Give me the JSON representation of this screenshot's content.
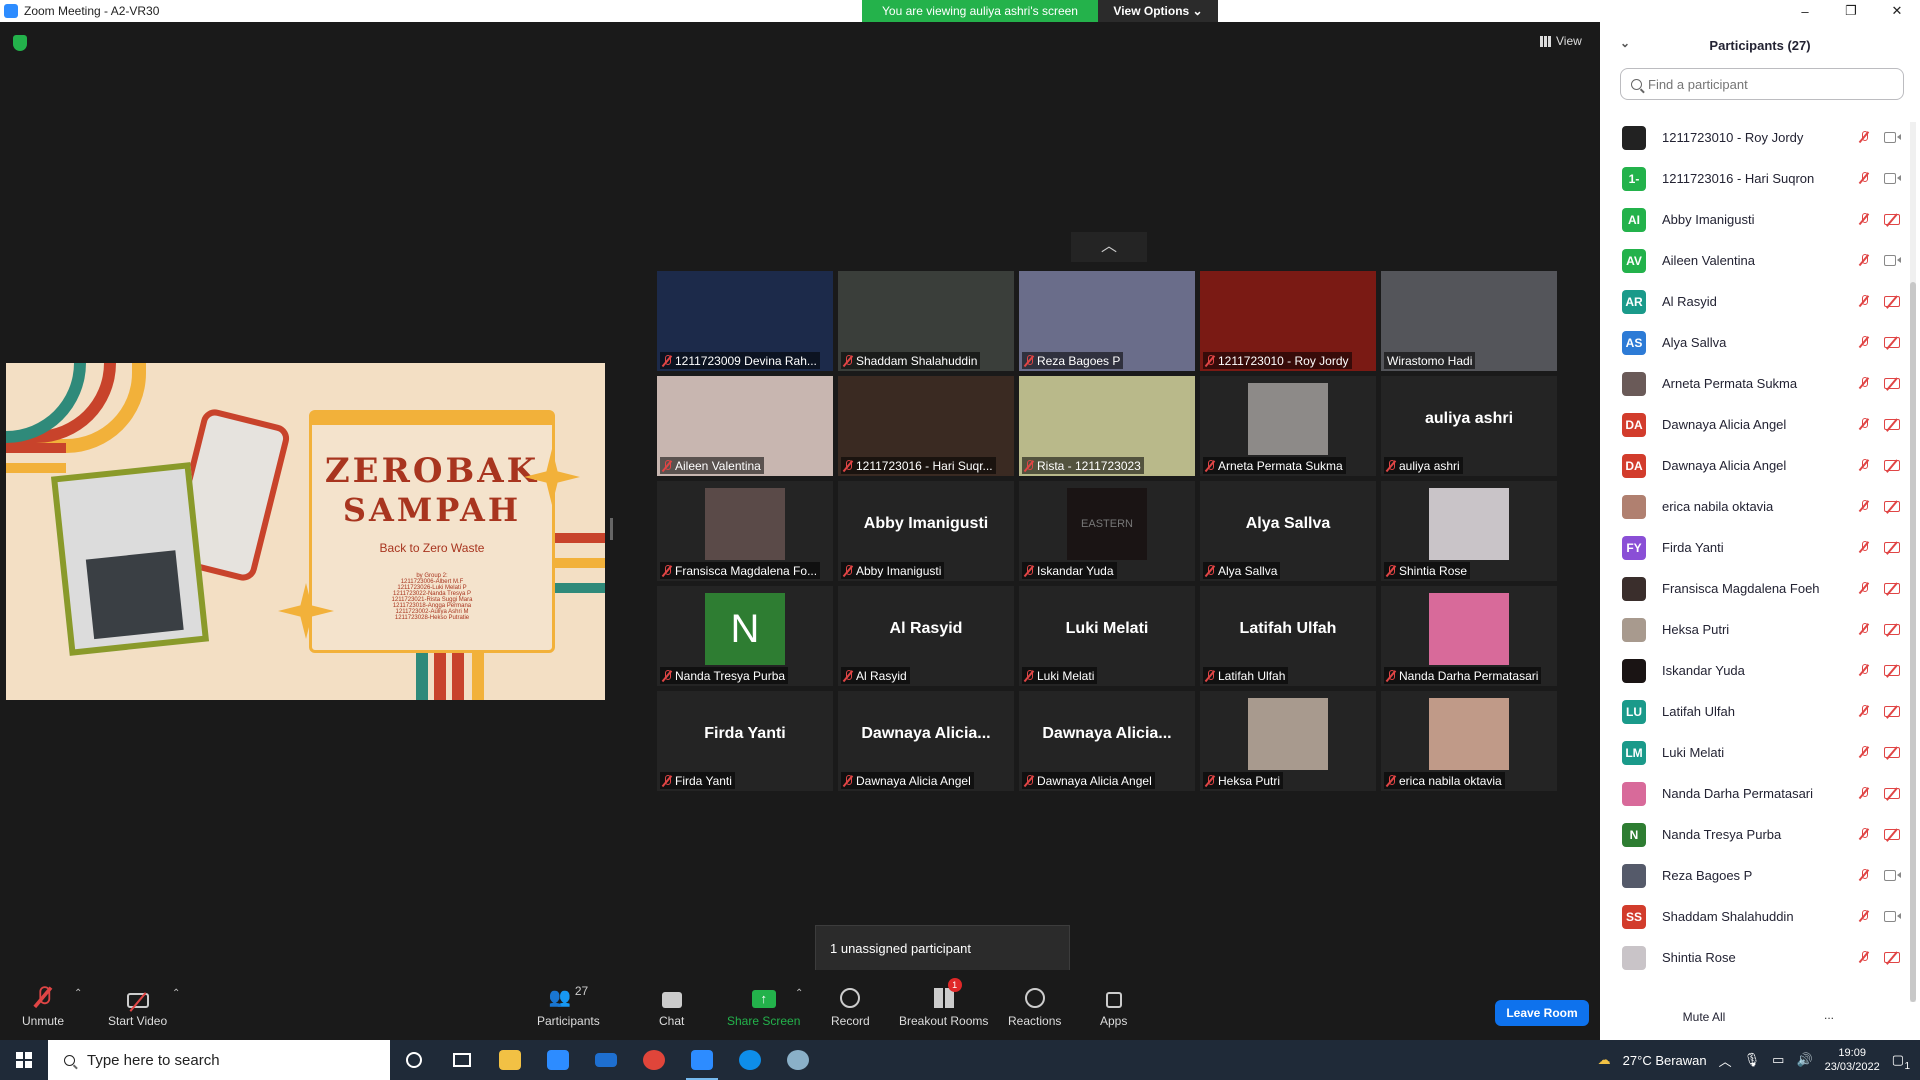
{
  "window": {
    "title": "Zoom Meeting - A2-VR30",
    "minimize": "–",
    "restore": "❐",
    "close": "✕"
  },
  "banner": {
    "viewing": "You are viewing auliya ashri's screen",
    "view_options": "View Options ⌄"
  },
  "view_button": "View",
  "collapse_arrow": "︿",
  "shared_slide": {
    "title_line1": "ZEROBAK",
    "title_line2": "SAMPAH",
    "subtitle": "Back to Zero Waste",
    "credits": [
      "by Group 2:",
      "1211723006-Albert M.F",
      "1211723026-Luki Melati P",
      "1211723022-Nanda Tresya P",
      "1211723021-Rista Suggi Mara",
      "1211723018-Angga Permana",
      "1211723002-Auliya Ashri M",
      "1211723028-Hekso Putratie"
    ],
    "colors": {
      "background": "#f3dfc4",
      "accent": "#f2b13a",
      "text": "#a8351f"
    }
  },
  "tiles": [
    {
      "name": "1211723009 Devina Rah...",
      "kind": "video",
      "color": "#1c2a4a"
    },
    {
      "name": "Shaddam Shalahuddin",
      "kind": "video",
      "color": "#3a3e3a"
    },
    {
      "name": "Reza Bagoes P",
      "kind": "video",
      "color": "#6a6d8a"
    },
    {
      "name": "1211723010 - Roy Jordy",
      "kind": "video",
      "color": "#7a1a14"
    },
    {
      "name": "Wirastomo Hadi",
      "kind": "video",
      "color": "#54555a"
    },
    {
      "name": "Aileen Valentina",
      "kind": "video",
      "color": "#c8b6b0"
    },
    {
      "name": "1211723016 - Hari Suqr...",
      "kind": "video",
      "color": "#3a2a22"
    },
    {
      "name": "Rista - 1211723023",
      "kind": "video",
      "color": "#b9b98a",
      "active": true
    },
    {
      "name": "Arneta Permata Sukma",
      "kind": "photo",
      "color": "#8d8a88"
    },
    {
      "name": "auliya ashri",
      "kind": "name",
      "display": "auliya ashri"
    },
    {
      "name": "Fransisca Magdalena Fo...",
      "kind": "photo",
      "color": "#5a4a48"
    },
    {
      "name": "Abby Imanigusti",
      "kind": "name",
      "display": "Abby Imanigusti"
    },
    {
      "name": "Iskandar Yuda",
      "kind": "photo",
      "color": "#1a1414",
      "photo_text": "EASTERN"
    },
    {
      "name": "Alya Sallva",
      "kind": "name",
      "display": "Alya Sallva"
    },
    {
      "name": "Shintia Rose",
      "kind": "photo",
      "color": "#c9c4c8"
    },
    {
      "name": "Nanda Tresya Purba",
      "kind": "letter",
      "color": "#2e7d32",
      "letter": "N"
    },
    {
      "name": "Al Rasyid",
      "kind": "name",
      "display": "Al Rasyid"
    },
    {
      "name": "Luki Melati",
      "kind": "name",
      "display": "Luki Melati"
    },
    {
      "name": "Latifah Ulfah",
      "kind": "name",
      "display": "Latifah Ulfah"
    },
    {
      "name": "Nanda Darha Permatasari",
      "kind": "photo",
      "color": "#d86a9a"
    },
    {
      "name": "Firda Yanti",
      "kind": "name",
      "display": "Firda Yanti"
    },
    {
      "name": "Dawnaya Alicia Angel",
      "kind": "name",
      "display": "Dawnaya  Alicia..."
    },
    {
      "name": "Dawnaya Alicia Angel",
      "kind": "name",
      "display": "Dawnaya  Alicia..."
    },
    {
      "name": "Heksa Putri",
      "kind": "photo",
      "color": "#a89a8e"
    },
    {
      "name": "erica nabila oktavia",
      "kind": "photo",
      "color": "#c09a88"
    }
  ],
  "toast": "1 unassigned participant",
  "toolbar": {
    "unmute": "Unmute",
    "start_video": "Start Video",
    "participants": "Participants",
    "participants_count": "27",
    "chat": "Chat",
    "share_screen": "Share Screen",
    "record": "Record",
    "breakout_rooms": "Breakout Rooms",
    "breakout_badge": "1",
    "reactions": "Reactions",
    "apps": "Apps",
    "leave": "Leave Room",
    "caret": "⌃"
  },
  "panel": {
    "title": "Participants (27)",
    "search_placeholder": "Find a participant",
    "mute_all": "Mute All",
    "more": "...",
    "participants": [
      {
        "name": "1211723010 - Roy Jordy",
        "avatar": "",
        "color": "#222222",
        "cam": "on"
      },
      {
        "name": "1211723016 - Hari Suqron",
        "avatar": "1-",
        "color": "#23b24b",
        "cam": "on"
      },
      {
        "name": "Abby Imanigusti",
        "avatar": "AI",
        "color": "#23b24b",
        "cam": "off"
      },
      {
        "name": "Aileen Valentina",
        "avatar": "AV",
        "color": "#23b24b",
        "cam": "on"
      },
      {
        "name": "Al Rasyid",
        "avatar": "AR",
        "color": "#1a9a8a",
        "cam": "off"
      },
      {
        "name": "Alya Sallva",
        "avatar": "AS",
        "color": "#2d7bd6",
        "cam": "off"
      },
      {
        "name": "Arneta Permata Sukma",
        "avatar": "",
        "color": "#6a5a58",
        "cam": "off"
      },
      {
        "name": "Dawnaya Alicia Angel",
        "avatar": "DA",
        "color": "#d23c2c",
        "cam": "off"
      },
      {
        "name": "Dawnaya Alicia Angel",
        "avatar": "DA",
        "color": "#d23c2c",
        "cam": "off"
      },
      {
        "name": "erica nabila oktavia",
        "avatar": "",
        "color": "#b08070",
        "cam": "off"
      },
      {
        "name": "Firda Yanti",
        "avatar": "FY",
        "color": "#8a4fd6",
        "cam": "off"
      },
      {
        "name": "Fransisca Magdalena Foeh",
        "avatar": "",
        "color": "#3a2e2c",
        "cam": "off"
      },
      {
        "name": "Heksa Putri",
        "avatar": "",
        "color": "#a89a8e",
        "cam": "off"
      },
      {
        "name": "Iskandar Yuda",
        "avatar": "",
        "color": "#1a1414",
        "cam": "off"
      },
      {
        "name": "Latifah Ulfah",
        "avatar": "LU",
        "color": "#1a9a8a",
        "cam": "off"
      },
      {
        "name": "Luki Melati",
        "avatar": "LM",
        "color": "#1a9a8a",
        "cam": "off"
      },
      {
        "name": "Nanda Darha Permatasari",
        "avatar": "",
        "color": "#d86a9a",
        "cam": "off"
      },
      {
        "name": "Nanda Tresya Purba",
        "avatar": "N",
        "color": "#2e7d32",
        "cam": "off"
      },
      {
        "name": "Reza Bagoes P",
        "avatar": "",
        "color": "#555a6a",
        "cam": "on"
      },
      {
        "name": "Shaddam Shalahuddin",
        "avatar": "SS",
        "color": "#d23c2c",
        "cam": "on"
      },
      {
        "name": "Shintia Rose",
        "avatar": "",
        "color": "#c9c4c8",
        "cam": "off"
      }
    ]
  },
  "taskbar": {
    "search_placeholder": "Type here to search",
    "weather": "27°C  Berawan",
    "time": "19:09",
    "date": "23/03/2022",
    "notification_count": "1"
  }
}
